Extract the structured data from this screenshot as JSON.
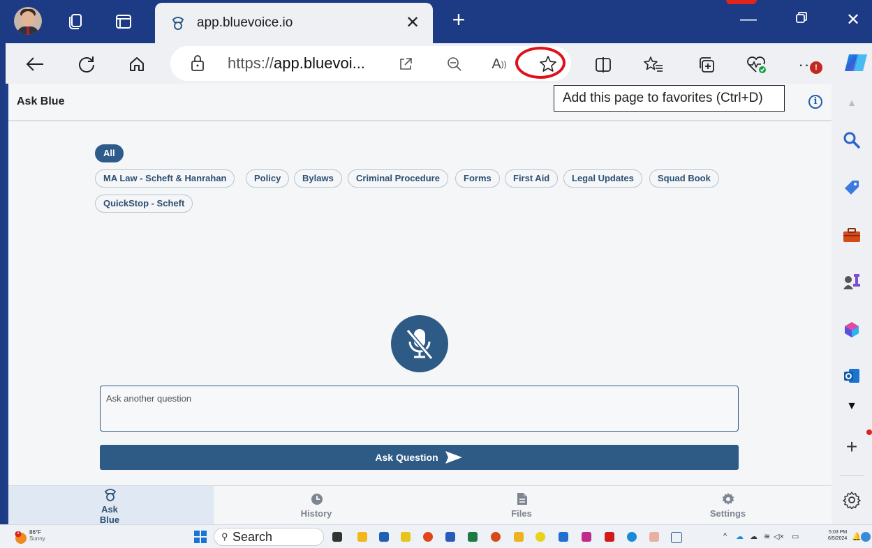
{
  "browser": {
    "tab_title": "app.bluevoice.io",
    "url_prefix": "https://",
    "url_host": "app.bluevoi...",
    "tooltip": "Add this page to favorites (Ctrl+D)",
    "notification_badge": "!"
  },
  "app": {
    "page_title": "Ask Blue",
    "info_icon": "i",
    "filters": [
      {
        "label": "All",
        "active": true
      },
      {
        "label": "MA Law - Scheft & Hanrahan"
      },
      {
        "label": "Policy"
      },
      {
        "label": "Bylaws"
      },
      {
        "label": "Criminal Procedure"
      },
      {
        "label": "Forms"
      },
      {
        "label": "First Aid"
      },
      {
        "label": "Legal Updates"
      },
      {
        "label": "Squad Book"
      },
      {
        "label": "QuickStop - Scheft"
      }
    ],
    "question_placeholder": "Ask another question",
    "ask_button": "Ask Question",
    "bottom_nav": [
      {
        "label": "Ask Blue",
        "icon": "police-officer-icon",
        "active": true
      },
      {
        "label": "History",
        "icon": "clock-icon"
      },
      {
        "label": "Files",
        "icon": "file-icon"
      },
      {
        "label": "Settings",
        "icon": "gear-icon"
      }
    ]
  },
  "taskbar": {
    "temperature": "86°F",
    "weather": "Sunny",
    "weather_badge": "1",
    "search": "Search",
    "time": "5:03 PM",
    "date": "6/5/2024"
  },
  "colors": {
    "brand": "#2e5b86",
    "frame": "#1d3b84",
    "highlight": "#e0101a"
  }
}
